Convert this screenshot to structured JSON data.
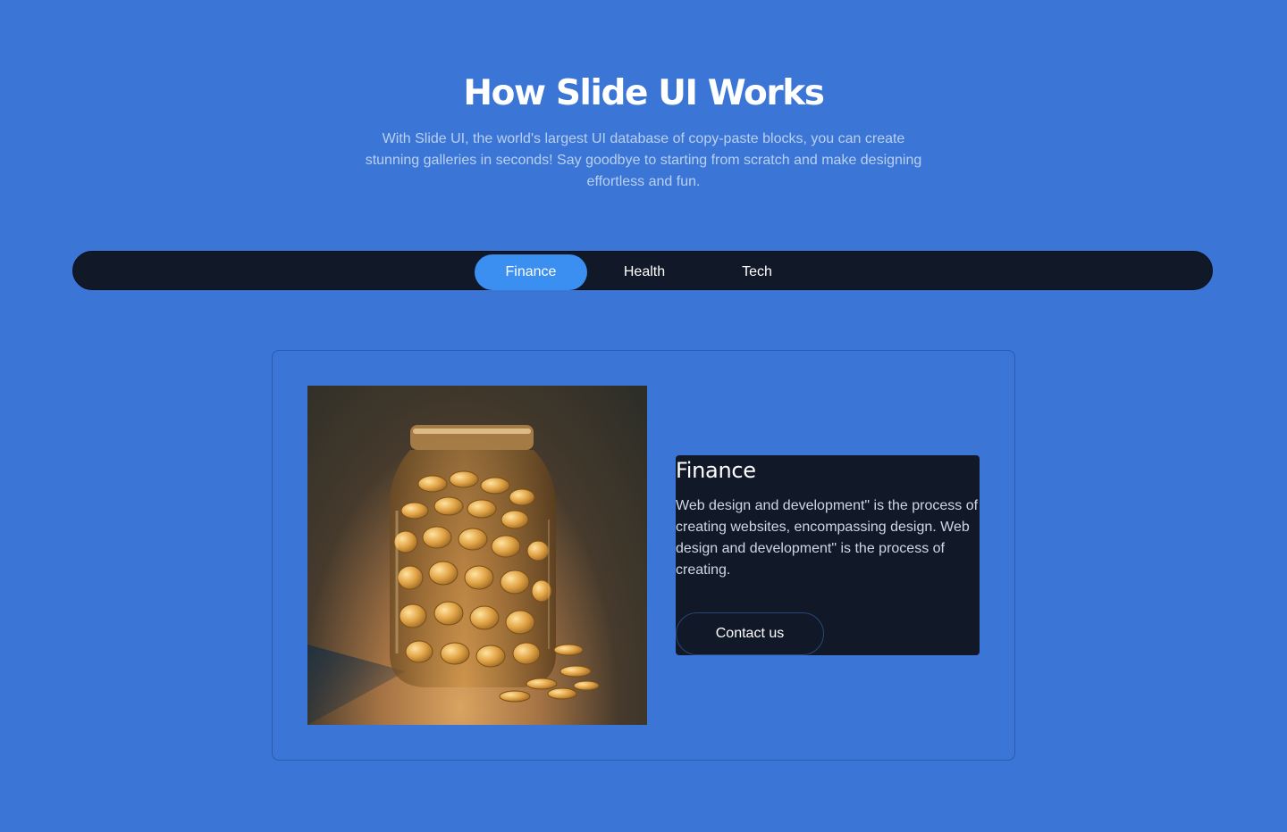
{
  "header": {
    "title": "How Slide UI Works",
    "subtitle": "With Slide UI, the world's largest UI database of copy-paste blocks, you can create stunning galleries in seconds! Say goodbye to starting from scratch and make designing effortless and fun."
  },
  "tabs": [
    {
      "label": "Finance",
      "active": true
    },
    {
      "label": "Health",
      "active": false
    },
    {
      "label": "Tech",
      "active": false
    }
  ],
  "content": {
    "image_icon": "coin-jar-image",
    "title": "Finance",
    "description": "Web design and development\" is the process of creating websites, encompassing design. Web design and development\" is the process of creating.",
    "button_label": "Contact us"
  },
  "colors": {
    "background": "#3b76d6",
    "tabbar": "#111827",
    "active_tab": "#3b8ff0",
    "panel": "#111827"
  }
}
